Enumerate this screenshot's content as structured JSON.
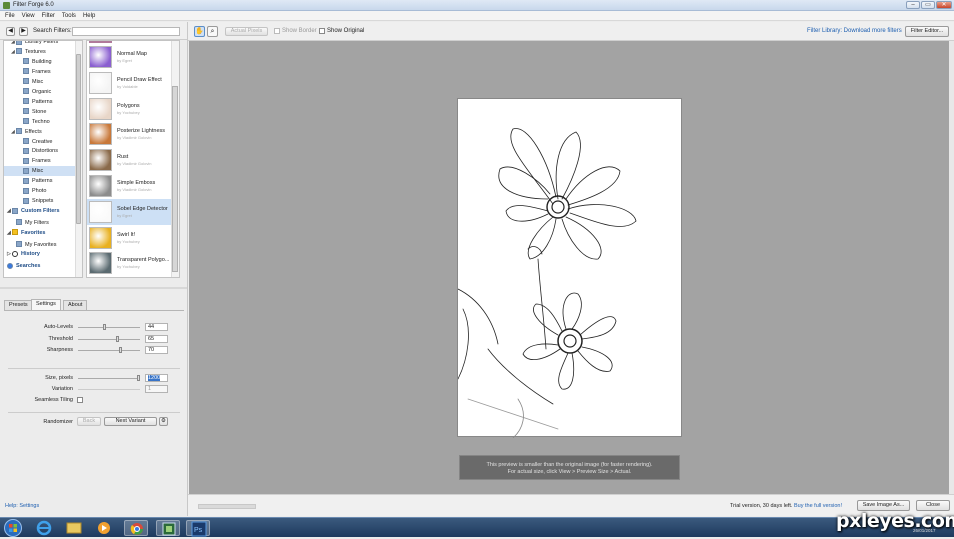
{
  "window": {
    "title": "Filter Forge 6.0",
    "min": "–",
    "max": "▭",
    "close": "✕"
  },
  "menu": [
    "File",
    "View",
    "Filter",
    "Tools",
    "Help"
  ],
  "search": {
    "label": "Search Filters:",
    "value": "",
    "back": "◀",
    "forward": "▶"
  },
  "tree": [
    {
      "label": "Library Filters",
      "level": 1,
      "arrow": "◢",
      "bold": false
    },
    {
      "label": "Textures",
      "level": 1,
      "arrow": "◢"
    },
    {
      "label": "Building",
      "level": 2
    },
    {
      "label": "Frames",
      "level": 2
    },
    {
      "label": "Misc",
      "level": 2
    },
    {
      "label": "Organic",
      "level": 2
    },
    {
      "label": "Patterns",
      "level": 2
    },
    {
      "label": "Stone",
      "level": 2
    },
    {
      "label": "Techno",
      "level": 2
    },
    {
      "label": "Effects",
      "level": 1,
      "arrow": "◢"
    },
    {
      "label": "Creative",
      "level": 2
    },
    {
      "label": "Distortions",
      "level": 2
    },
    {
      "label": "Frames",
      "level": 2
    },
    {
      "label": "Misc",
      "level": 2,
      "selected": true
    },
    {
      "label": "Patterns",
      "level": 2
    },
    {
      "label": "Photo",
      "level": 2
    },
    {
      "label": "Snippets",
      "level": 2
    },
    {
      "label": "Custom Filters",
      "level": 0,
      "arrow": "◢",
      "bold": true
    },
    {
      "label": "My Filters",
      "level": 1
    },
    {
      "label": "Favorites",
      "level": 0,
      "arrow": "◢",
      "bold": true
    },
    {
      "label": "My Favorites",
      "level": 1
    },
    {
      "label": "History",
      "level": 0,
      "arrow": "▷",
      "bold": true
    },
    {
      "label": "Searches",
      "level": 0,
      "bold": true
    }
  ],
  "filters": [
    {
      "name": "Normal Map",
      "by": "by Egret",
      "color": "#8a5fd0"
    },
    {
      "name": "Pencil Draw Effect",
      "by": "by Voidable",
      "color": "#f4f4f4"
    },
    {
      "name": "Polygons",
      "by": "by Yochubey",
      "color": "#e8d6c8"
    },
    {
      "name": "Posterize Lightness",
      "by": "by Vladimir Golovin",
      "color": "#c8783a"
    },
    {
      "name": "Rust",
      "by": "by Vladimir Golovin",
      "color": "#8a6a4a"
    },
    {
      "name": "Simple Emboss",
      "by": "by Vladimir Golovin",
      "color": "#8c8c8c"
    },
    {
      "name": "Sobel Edge Detector",
      "by": "by Egret",
      "color": "#fafafa",
      "selected": true
    },
    {
      "name": "Swirl It!",
      "by": "by Yochubey",
      "color": "#e8b020"
    },
    {
      "name": "Transparent Polygo...",
      "by": "by Yochubey",
      "color": "#5a6a70"
    }
  ],
  "tabs": [
    {
      "label": "Presets"
    },
    {
      "label": "Settings",
      "active": true
    },
    {
      "label": "About"
    }
  ],
  "settings": {
    "auto_levels": {
      "label": "Auto-Levels",
      "value": "44",
      "level": 0.44
    },
    "threshold": {
      "label": "Threshold",
      "value": "65",
      "level": 0.65
    },
    "sharpness": {
      "label": "Sharpness",
      "value": "70",
      "level": 0.7
    },
    "size": {
      "label": "Size, pixels",
      "value": "1200",
      "level": 0.98
    },
    "variation": {
      "label": "Variation",
      "value": "1"
    },
    "seamless": {
      "label": "Seamless Tiling"
    },
    "randomizer": {
      "label": "Randomizer",
      "back": "Back",
      "next": "Next Variant"
    }
  },
  "help": "Help: Settings",
  "toolbar": {
    "actual_pixels": "Actual Pixels",
    "show_border": "Show Border",
    "show_original": "Show Original",
    "library_link": "Filter Library: Download more filters",
    "editor": "Filter Editor..."
  },
  "preview_note": {
    "line1": "This preview is smaller than the original image (for faster rendering).",
    "line2": "For actual size, click View > Preview Size > Actual."
  },
  "status": {
    "trial": "Trial version, 30 days left.",
    "buy": "Buy the full version!",
    "save": "Save Image As...",
    "close": "Close"
  },
  "watermark": {
    "site": "pxleyes.com",
    "date": "26/01/2017"
  }
}
